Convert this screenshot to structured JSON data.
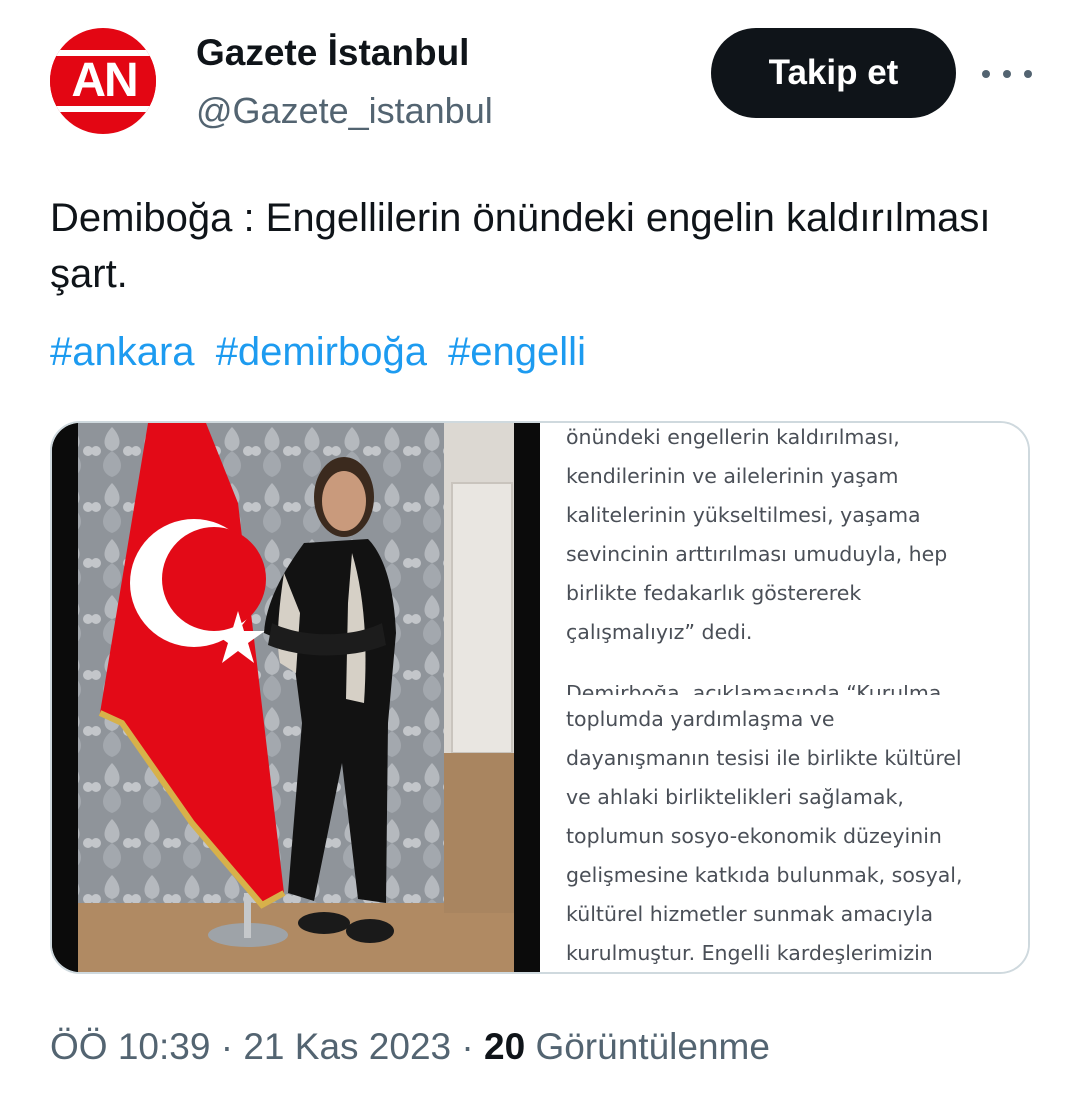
{
  "account": {
    "avatar_logo": "AN",
    "name": "Gazete İstanbul",
    "handle": "@Gazete_istanbul",
    "follow_label": "Takip et",
    "more_icon": "more-horizontal-icon"
  },
  "tweet": {
    "text": "Demiboğa : Engellilerin önündeki engelin kaldırılması şart.",
    "hashtags": [
      "#ankara",
      "#demirboğa",
      "#engelli"
    ]
  },
  "media": {
    "article_lines_top": [
      "önündeki engellerin kaldırılması,",
      "kendilerinin ve ailelerinin yaşam",
      "kalitelerinin yükseltilmesi, yaşama",
      "sevincinin arttırılması umuduyla, hep",
      "birlikte fedakarlık göstererek",
      "çalışmalıyız” dedi."
    ],
    "article_cut_line": "Demirboğa, açıklamasında “Kurulma",
    "article_lines_bottom": [
      "toplumda yardımlaşma ve",
      "dayanışmanın tesisi ile birlikte kültürel",
      "ve ahlaki birliktelikleri sağlamak,",
      "toplumun sosyo-ekonomik düzeyinin",
      "gelişmesine katkıda bulunmak, sosyal,",
      "kültürel hizmetler sunmak amacıyla",
      "kurulmuştur. Engelli kardeşlerimizin"
    ]
  },
  "meta": {
    "time": "ÖÖ 10:39",
    "separator": " · ",
    "date": "21 Kas 2023",
    "views_count": "20",
    "views_label": "Görüntülenme"
  },
  "colors": {
    "text": "#0f1419",
    "secondary": "#536471",
    "link": "#1d9bf0",
    "button": "#0f1419",
    "logo_red": "#e30613",
    "flag_red": "#e30a17"
  }
}
